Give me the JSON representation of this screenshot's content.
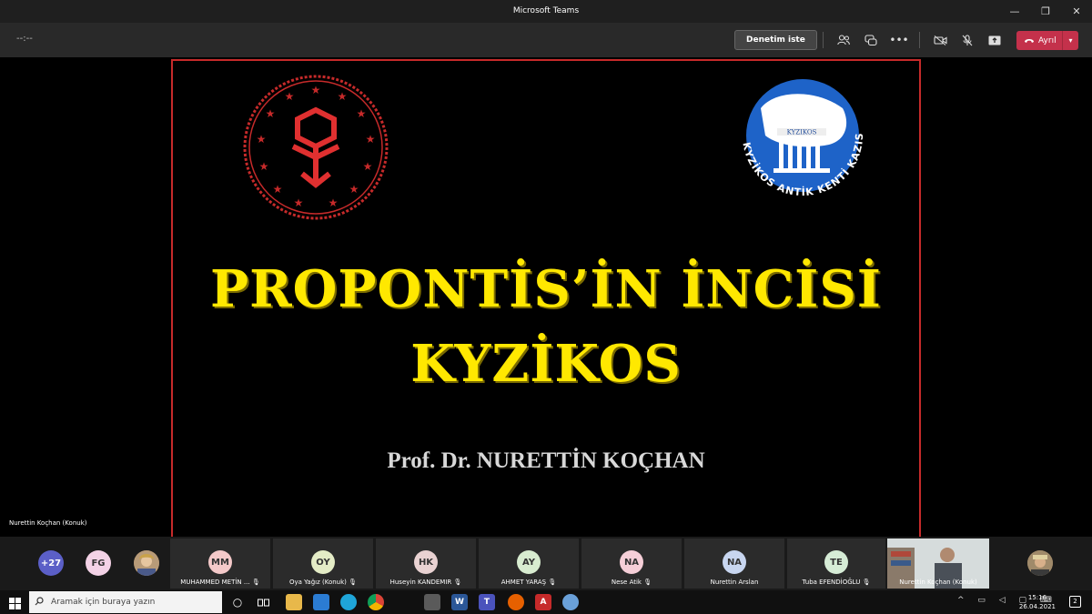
{
  "window": {
    "title": "Microsoft Teams",
    "minimize": "—",
    "restore": "❐",
    "close": "✕"
  },
  "toolbar": {
    "timer": "--:--",
    "request_control": "Denetim iste",
    "people_icon": "people-icon",
    "chat_icon": "chat-icon",
    "more": "•••",
    "leave_label": "Ayrıl",
    "leave_color": "#c4314b"
  },
  "slide": {
    "title_line1": "PROPONTİS’İN İNCİSİ",
    "title_line2": "KYZİKOS",
    "author": "Prof. Dr. NURETTİN KOÇHAN",
    "right_logo_text": "KYZİKOS ANTİK KENTİ KAZISI",
    "right_logo_banner": "KYZIKOS",
    "title_color": "#ffe800",
    "border_color": "#c62a2a"
  },
  "presenter": {
    "name": "Nurettin Koçhan (Konuk)"
  },
  "participants": {
    "overflow": "+27",
    "fg": "FG",
    "tiles": [
      {
        "initials": "MM",
        "name": "MUHAMMED METİN ...",
        "color": "#f4c9c9"
      },
      {
        "initials": "OY",
        "name": "Oya Yağız (Konuk)",
        "color": "#e4ecc6"
      },
      {
        "initials": "HK",
        "name": "Huseyin KANDEMIR",
        "color": "#e9d2d2"
      },
      {
        "initials": "AY",
        "name": "AHMET YARAŞ",
        "color": "#d8ecd0"
      },
      {
        "initials": "NA",
        "name": "Nese Atik",
        "color": "#f6cfd8"
      },
      {
        "initials": "NA",
        "name": "Nurettin Arslan",
        "color": "#c8d6f0"
      },
      {
        "initials": "TE",
        "name": "Tuba EFENDİOĞLU",
        "color": "#d6ecd6"
      }
    ],
    "video_name": "Nurettin Koçhan (Konuk)"
  },
  "taskbar": {
    "search_placeholder": "Aramak için buraya yazın",
    "time": "15:16",
    "date": "26.04.2021",
    "notifications": "2"
  }
}
